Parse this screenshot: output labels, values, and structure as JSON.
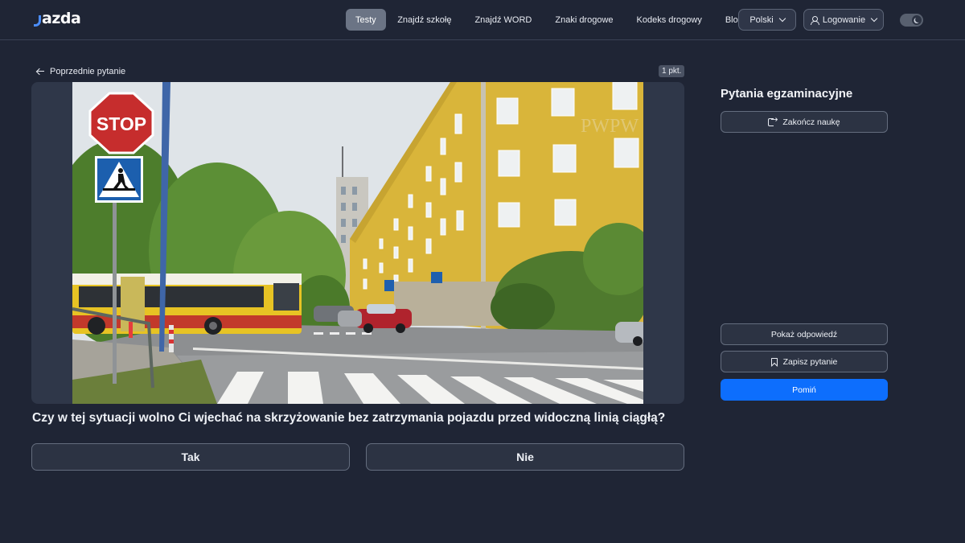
{
  "header": {
    "logo_text": "azda",
    "nav": [
      {
        "label": "Testy",
        "active": true
      },
      {
        "label": "Znajdź szkołę",
        "active": false
      },
      {
        "label": "Znajdź WORD",
        "active": false
      },
      {
        "label": "Znaki drogowe",
        "active": false
      },
      {
        "label": "Kodeks drogowy",
        "active": false
      },
      {
        "label": "Blog",
        "active": false
      }
    ],
    "language_label": "Polski",
    "login_label": "Logowanie",
    "theme_toggle": "dark"
  },
  "question": {
    "back_label": "Poprzednie pytanie",
    "points_label": "1 pkt.",
    "image_watermark": "PWPW",
    "stop_sign_text": "STOP",
    "text": "Czy w tej sytuacji wolno Ci wjechać na skrzyżowanie bez zatrzymania pojazdu przed widoczną linią ciągłą?",
    "answers": {
      "yes": "Tak",
      "no": "Nie"
    }
  },
  "sidebar": {
    "title": "Pytania egzaminacyjne",
    "finish_label": "Zakończ naukę",
    "show_answer_label": "Pokaż odpowiedź",
    "save_label": "Zapisz pytanie",
    "skip_label": "Pomiń"
  },
  "colors": {
    "background": "#1f2535",
    "primary": "#0d6efd",
    "nav_active": "#6b7485",
    "accent_logo": "#4b8df8"
  }
}
